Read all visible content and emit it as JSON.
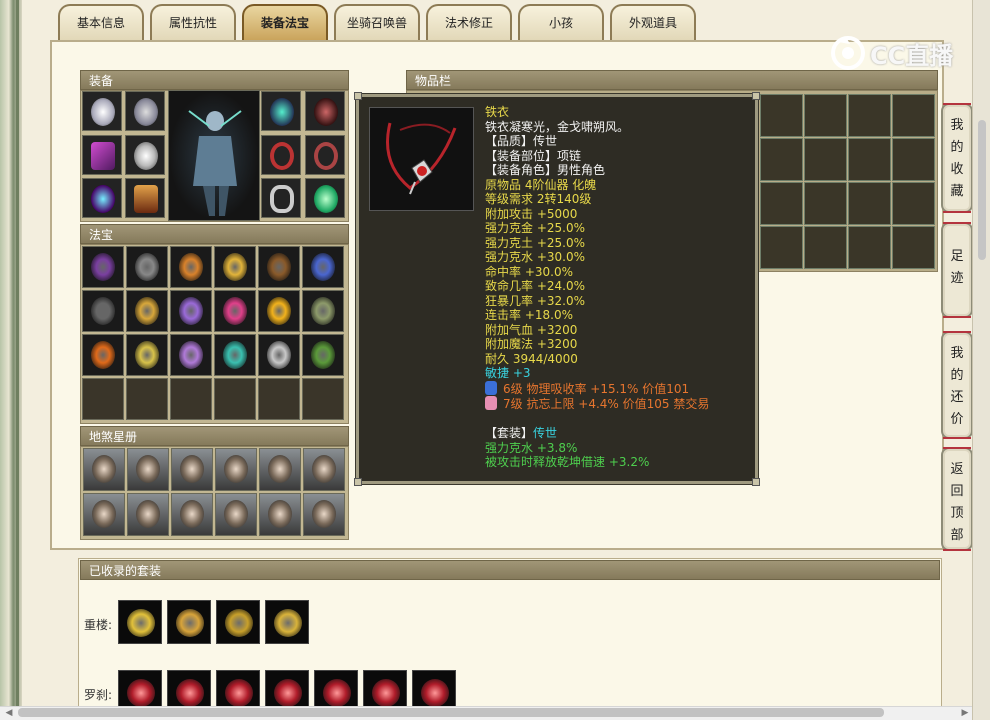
{
  "tabs": [
    {
      "label": "基本信息",
      "active": false
    },
    {
      "label": "属性抗性",
      "active": false
    },
    {
      "label": "装备法宝",
      "active": true
    },
    {
      "label": "坐骑召唤兽",
      "active": false
    },
    {
      "label": "法术修正",
      "active": false
    },
    {
      "label": "小孩",
      "active": false
    },
    {
      "label": "外观道具",
      "active": false
    }
  ],
  "watermark": {
    "text": "CC直播",
    "icon": "cc-logo-icon"
  },
  "sections": {
    "equipment": "装备",
    "fabao": "法宝",
    "disha": "地煞星册",
    "inventory": "物品栏",
    "collected_sets": "已收录的套装"
  },
  "tooltip": {
    "name": "铁衣",
    "description": "铁衣凝寒光，金戈啸朔风。",
    "quality": "【品质】传世",
    "slot": "【装备部位】项链",
    "role": "【装备角色】男性角色",
    "origin": "原物品 4阶仙器 化魄",
    "level_req": "等级需求 2转140级",
    "stats": [
      "附加攻击 +5000",
      "强力克金 +25.0%",
      "强力克土 +25.0%",
      "强力克水 +30.0%",
      "命中率 +30.0%",
      "致命几率 +24.0%",
      "狂暴几率 +32.0%",
      "连击率 +18.0%",
      "附加气血 +3200",
      "附加魔法 +3200"
    ],
    "durability": "耐久 3944/4000",
    "agility": "敏捷 +3",
    "gems": [
      {
        "text": "6级 物理吸收率 +15.1% 价值101",
        "color": "#3b6fd8"
      },
      {
        "text": "7级 抗忘上限 +4.4% 价值105 禁交易",
        "color": "#e78fb3"
      }
    ],
    "set_label": "【套装】",
    "set_name": "传世",
    "set_bonuses": [
      "强力克水 +3.8%",
      "被攻击时释放乾坤借速 +3.2%"
    ]
  },
  "side_buttons": [
    {
      "label": "我的收藏"
    },
    {
      "label": "足迹"
    },
    {
      "label": "我的还价"
    },
    {
      "label": "返回顶部"
    }
  ],
  "set_rows": [
    {
      "label": "重楼:",
      "count": 4
    },
    {
      "label": "罗刹:",
      "count": 7
    }
  ],
  "colors": {
    "accent": "#caa45c",
    "tooltip_bg": "#2e2c24",
    "yellow_text": "#e7d84a",
    "cyan_text": "#39d3e0",
    "green_text": "#4ecf4e",
    "orange_text": "#e6752e"
  }
}
